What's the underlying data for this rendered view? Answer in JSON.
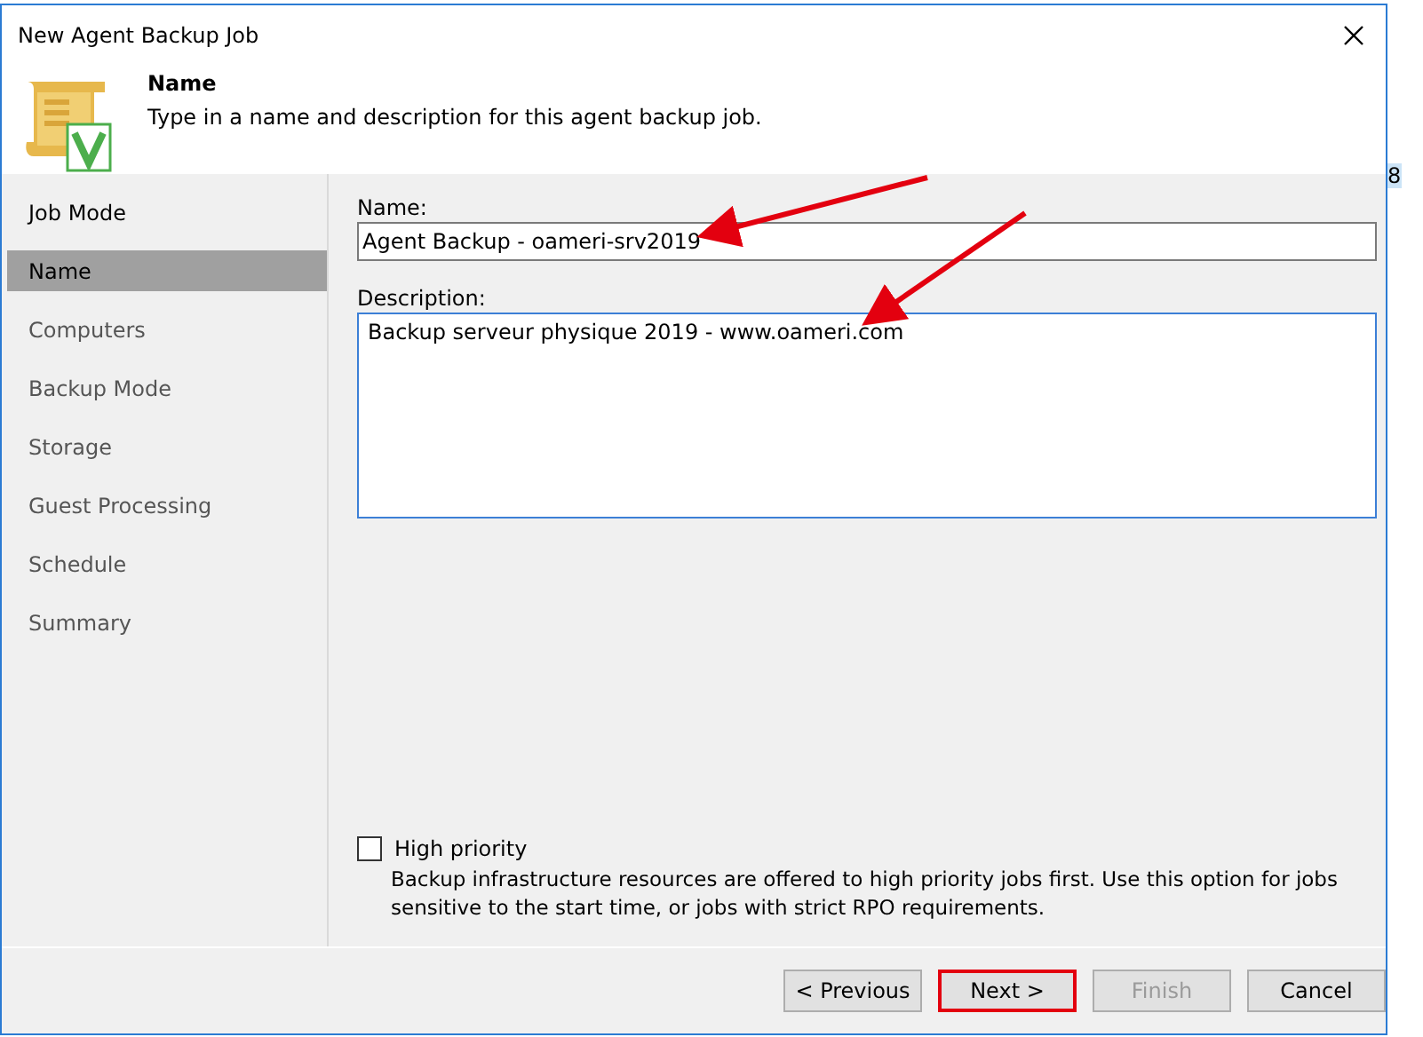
{
  "window": {
    "title": "New Agent Backup Job"
  },
  "header": {
    "title": "Name",
    "subtitle": "Type in a name and description for this agent backup job."
  },
  "background": {
    "text": "8"
  },
  "sidebar": {
    "items": [
      {
        "label": "Job Mode",
        "selected": false,
        "done": true
      },
      {
        "label": "Name",
        "selected": true,
        "done": true
      },
      {
        "label": "Computers",
        "selected": false,
        "done": false
      },
      {
        "label": "Backup Mode",
        "selected": false,
        "done": false
      },
      {
        "label": "Storage",
        "selected": false,
        "done": false
      },
      {
        "label": "Guest Processing",
        "selected": false,
        "done": false
      },
      {
        "label": "Schedule",
        "selected": false,
        "done": false
      },
      {
        "label": "Summary",
        "selected": false,
        "done": false
      }
    ]
  },
  "form": {
    "name": {
      "label": "Name:",
      "value": "Agent Backup - oameri-srv2019"
    },
    "description": {
      "label": "Description:",
      "value": "Backup serveur physique 2019 - www.oameri.com"
    },
    "high_priority": {
      "label": "High priority",
      "checked": false,
      "note": "Backup infrastructure resources are offered to high priority jobs first. Use this option for jobs sensitive to the start time, or jobs with strict RPO requirements."
    }
  },
  "buttons": [
    {
      "label": "< Previous",
      "disabled": false,
      "highlighted": false
    },
    {
      "label": "Next >",
      "disabled": false,
      "highlighted": true
    },
    {
      "label": "Finish",
      "disabled": true,
      "highlighted": false
    },
    {
      "label": "Cancel",
      "disabled": false,
      "highlighted": false
    }
  ]
}
